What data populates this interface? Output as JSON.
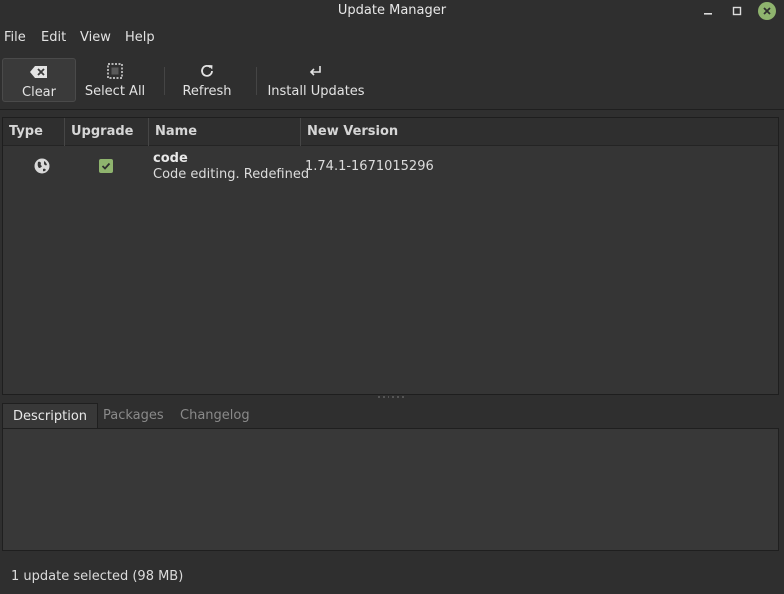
{
  "window": {
    "title": "Update Manager"
  },
  "menubar": {
    "items": [
      "File",
      "Edit",
      "View",
      "Help"
    ]
  },
  "toolbar": {
    "clear_label": "Clear",
    "select_all_label": "Select All",
    "refresh_label": "Refresh",
    "install_label": "Install Updates"
  },
  "table": {
    "columns": [
      "Type",
      "Upgrade",
      "Name",
      "New Version"
    ],
    "rows": [
      {
        "type_icon": "globe-icon",
        "upgrade": true,
        "name": "code",
        "description": "Code editing. Redefined",
        "new_version": "1.74.1-1671015296"
      }
    ]
  },
  "tabs": [
    "Description",
    "Packages",
    "Changelog"
  ],
  "status": {
    "text": "1 update selected (98 MB)"
  },
  "colors": {
    "accent": "#8fb46e",
    "background": "#2f2f2f"
  }
}
